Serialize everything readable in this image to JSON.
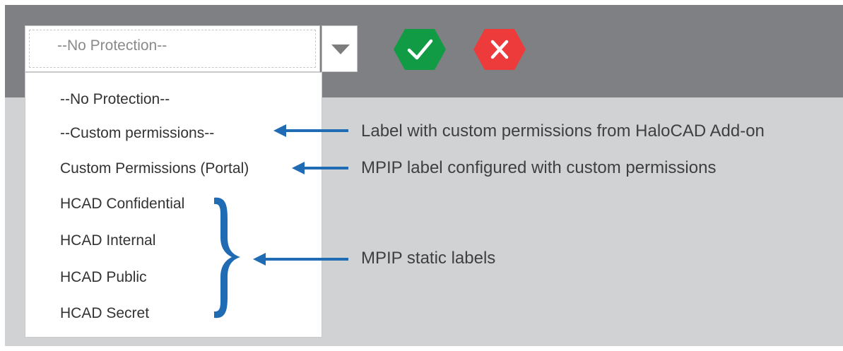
{
  "select": {
    "current_value": "--No Protection--"
  },
  "actions": {
    "confirm_icon": "check-icon",
    "cancel_icon": "close-icon",
    "confirm_color": "#119b45",
    "cancel_color": "#ed3b3c"
  },
  "dropdown": {
    "options": [
      "--No Protection--",
      "--Custom permissions--",
      "Custom Permissions (Portal)",
      "HCAD Confidential",
      "HCAD Internal",
      "HCAD Public",
      "HCAD Secret"
    ]
  },
  "annotations": {
    "custom_label": "Label with custom permissions from HaloCAD Add-on",
    "mpip_custom": "MPIP label configured with custom permissions",
    "mpip_static": "MPIP static labels",
    "arrow_color": "#1f6cb5"
  }
}
